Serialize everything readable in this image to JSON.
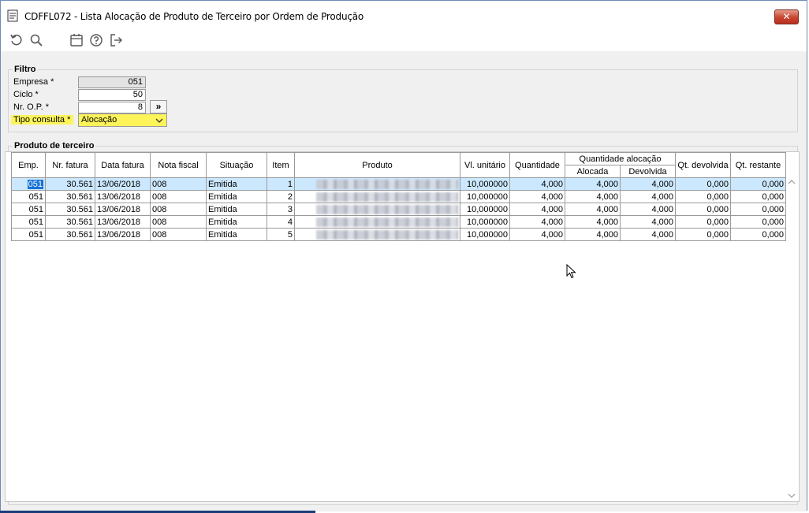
{
  "window": {
    "title": "CDFFL072 - Lista Alocação de Produto de Terceiro por Ordem de Produção",
    "close_label": "✕"
  },
  "toolbar": {
    "icons": [
      "refresh-icon",
      "search-icon",
      "calendar-icon",
      "help-icon",
      "exit-icon"
    ]
  },
  "filtro": {
    "legend": "Filtro",
    "empresa_label": "Empresa *",
    "empresa_value": "051",
    "ciclo_label": "Ciclo *",
    "ciclo_value": "50",
    "nrop_label": "Nr. O.P. *",
    "nrop_value": "8",
    "nrop_button": "»",
    "tipo_label": "Tipo consulta *",
    "tipo_value": "Alocação"
  },
  "produto": {
    "legend": "Produto de terceiro",
    "headers": {
      "emp": "Emp.",
      "nr_fatura": "Nr. fatura",
      "data_fatura": "Data fatura",
      "nota_fiscal": "Nota fiscal",
      "situacao": "Situação",
      "item": "Item",
      "produto": "Produto",
      "vl_unitario": "Vl. unitário",
      "quantidade": "Quantidade",
      "qtd_alocacao": "Quantidade alocação",
      "alocada": "Alocada",
      "devolvida": "Devolvida",
      "qt_devolvida": "Qt. devolvida",
      "qt_restante": "Qt. restante"
    },
    "rows": [
      {
        "emp": "051",
        "nr_fatura": "30.561",
        "data_fatura": "13/06/2018",
        "nota_fiscal": "008",
        "situacao": "Emitida",
        "item": "1",
        "vl_unitario": "10,000000",
        "quantidade": "4,000",
        "alocada": "4,000",
        "devolvida": "4,000",
        "qt_devolvida": "0,000",
        "qt_restante": "0,000"
      },
      {
        "emp": "051",
        "nr_fatura": "30.561",
        "data_fatura": "13/06/2018",
        "nota_fiscal": "008",
        "situacao": "Emitida",
        "item": "2",
        "vl_unitario": "10,000000",
        "quantidade": "4,000",
        "alocada": "4,000",
        "devolvida": "4,000",
        "qt_devolvida": "0,000",
        "qt_restante": "0,000"
      },
      {
        "emp": "051",
        "nr_fatura": "30.561",
        "data_fatura": "13/06/2018",
        "nota_fiscal": "008",
        "situacao": "Emitida",
        "item": "3",
        "vl_unitario": "10,000000",
        "quantidade": "4,000",
        "alocada": "4,000",
        "devolvida": "4,000",
        "qt_devolvida": "0,000",
        "qt_restante": "0,000"
      },
      {
        "emp": "051",
        "nr_fatura": "30.561",
        "data_fatura": "13/06/2018",
        "nota_fiscal": "008",
        "situacao": "Emitida",
        "item": "4",
        "vl_unitario": "10,000000",
        "quantidade": "4,000",
        "alocada": "4,000",
        "devolvida": "4,000",
        "qt_devolvida": "0,000",
        "qt_restante": "0,000"
      },
      {
        "emp": "051",
        "nr_fatura": "30.561",
        "data_fatura": "13/06/2018",
        "nota_fiscal": "008",
        "situacao": "Emitida",
        "item": "5",
        "vl_unitario": "10,000000",
        "quantidade": "4,000",
        "alocada": "4,000",
        "devolvida": "4,000",
        "qt_devolvida": "0,000",
        "qt_restante": "0,000"
      }
    ]
  }
}
